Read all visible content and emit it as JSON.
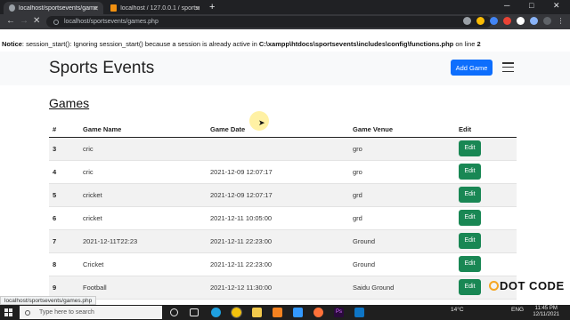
{
  "browser": {
    "tabs": [
      {
        "title": "localhost/sportsevents/games.ph",
        "active": true
      },
      {
        "title": "localhost / 127.0.0.1 / sportseve",
        "active": false
      }
    ],
    "url": "localhost/sportsevents/games.php",
    "status_url": "localhost/sportsevents/games.php"
  },
  "notice": {
    "label": "Notice",
    "message": ": session_start(): Ignoring session_start() because a session is already active in ",
    "path": "C:\\xampp\\htdocs\\sportsevents\\includes\\config\\functions.php",
    "on_line": " on line ",
    "line": "2"
  },
  "navbar": {
    "brand": "Sports Events",
    "add_button": "Add Game"
  },
  "page": {
    "title": "Games"
  },
  "table": {
    "headers": [
      "#",
      "Game Name",
      "Game Date",
      "Game Venue",
      "Edit"
    ],
    "edit_label": "Edit",
    "rows": [
      {
        "id": "3",
        "name": "cric",
        "date": "",
        "venue": "gro"
      },
      {
        "id": "4",
        "name": "cric",
        "date": "2021-12-09 12:07:17",
        "venue": "gro"
      },
      {
        "id": "5",
        "name": "cricket",
        "date": "2021-12-09 12:07:17",
        "venue": "grd"
      },
      {
        "id": "6",
        "name": "cricket",
        "date": "2021-12-11 10:05:00",
        "venue": "grd"
      },
      {
        "id": "7",
        "name": "2021-12-11T22:23",
        "date": "2021-12-11 22:23:00",
        "venue": "Ground"
      },
      {
        "id": "8",
        "name": "Cricket",
        "date": "2021-12-11 22:23:00",
        "venue": "Ground"
      },
      {
        "id": "9",
        "name": "Football",
        "date": "2021-12-12 11:30:00",
        "venue": "Saidu Ground"
      }
    ]
  },
  "watermark": "DOT CODE",
  "taskbar": {
    "search_placeholder": "Type here to search",
    "weather": "14°C",
    "lang": "ENG",
    "time": "11:45 PM",
    "date": "12/11/2021"
  },
  "colors": {
    "primary": "#0d6efd",
    "success": "#198754",
    "navbar_bg": "#f8f9fa"
  }
}
